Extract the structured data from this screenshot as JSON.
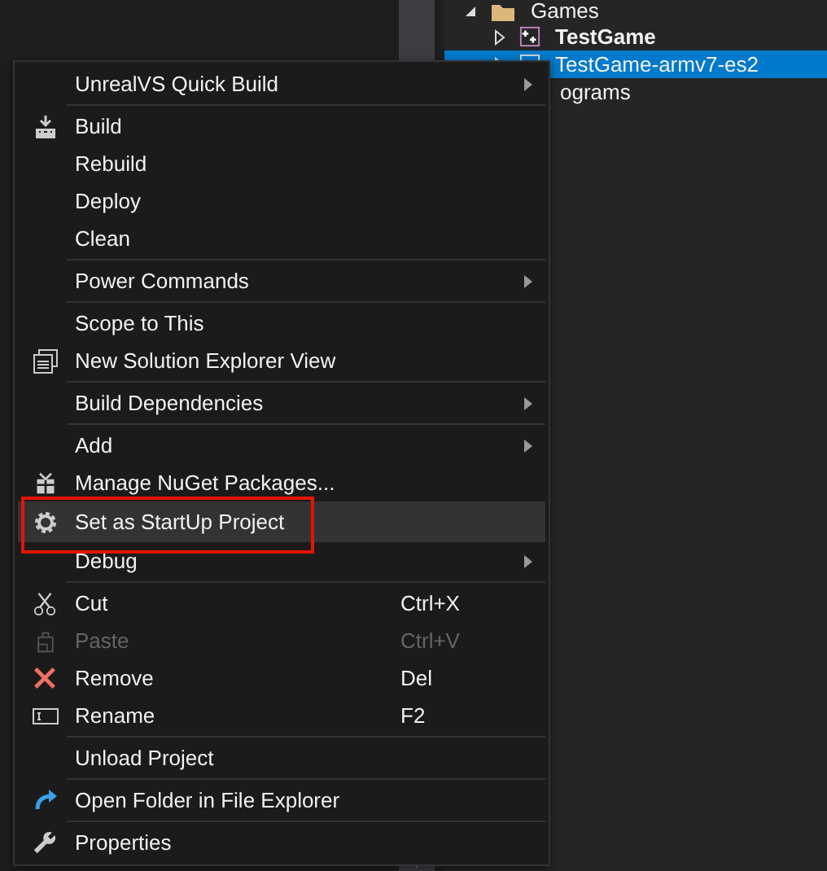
{
  "tree": {
    "items": [
      {
        "label": "Games",
        "expanded": true,
        "bold": false,
        "selected": false,
        "kind": "folder"
      },
      {
        "label": "TestGame",
        "expanded": false,
        "bold": true,
        "selected": false,
        "kind": "project"
      },
      {
        "label": "TestGame-armv7-es2",
        "expanded": false,
        "bold": false,
        "selected": true,
        "kind": "project"
      },
      {
        "label": "ograms",
        "kind": "hidden"
      }
    ]
  },
  "menu": {
    "items": [
      {
        "kind": "item",
        "label": "UnrealVS Quick Build",
        "submenu": true,
        "disabled": false,
        "selected": false,
        "annotated": false
      },
      {
        "kind": "separator"
      },
      {
        "kind": "item",
        "label": "Build",
        "submenu": false,
        "disabled": false,
        "selected": false,
        "annotated": false
      },
      {
        "kind": "item",
        "label": "Rebuild",
        "submenu": false,
        "disabled": false,
        "selected": false,
        "annotated": false
      },
      {
        "kind": "item",
        "label": "Deploy",
        "submenu": false,
        "disabled": false,
        "selected": false,
        "annotated": false
      },
      {
        "kind": "item",
        "label": "Clean",
        "submenu": false,
        "disabled": false,
        "selected": false,
        "annotated": false
      },
      {
        "kind": "separator"
      },
      {
        "kind": "item",
        "label": "Power Commands",
        "submenu": true,
        "disabled": false,
        "selected": false,
        "annotated": false
      },
      {
        "kind": "separator"
      },
      {
        "kind": "item",
        "label": "Scope to This",
        "submenu": false,
        "disabled": false,
        "selected": false,
        "annotated": false
      },
      {
        "kind": "item",
        "label": "New Solution Explorer View",
        "submenu": false,
        "disabled": false,
        "selected": false,
        "annotated": false
      },
      {
        "kind": "separator"
      },
      {
        "kind": "item",
        "label": "Build Dependencies",
        "submenu": true,
        "disabled": false,
        "selected": false,
        "annotated": false
      },
      {
        "kind": "separator"
      },
      {
        "kind": "item",
        "label": "Add",
        "submenu": true,
        "disabled": false,
        "selected": false,
        "annotated": false
      },
      {
        "kind": "item",
        "label": "Manage NuGet Packages...",
        "submenu": false,
        "disabled": false,
        "selected": false,
        "annotated": false
      },
      {
        "kind": "item",
        "label": "Set as StartUp Project",
        "submenu": false,
        "disabled": false,
        "selected": true,
        "annotated": true
      },
      {
        "kind": "item",
        "label": "Debug",
        "submenu": true,
        "disabled": false,
        "selected": false,
        "annotated": false
      },
      {
        "kind": "separator"
      },
      {
        "kind": "item",
        "label": "Cut",
        "shortcut": "Ctrl+X",
        "submenu": false,
        "disabled": false,
        "selected": false,
        "annotated": false
      },
      {
        "kind": "item",
        "label": "Paste",
        "shortcut": "Ctrl+V",
        "submenu": false,
        "disabled": true,
        "selected": false,
        "annotated": false
      },
      {
        "kind": "item",
        "label": "Remove",
        "shortcut": "Del",
        "submenu": false,
        "disabled": false,
        "selected": false,
        "annotated": false
      },
      {
        "kind": "item",
        "label": "Rename",
        "shortcut": "F2",
        "submenu": false,
        "disabled": false,
        "selected": false,
        "annotated": false
      },
      {
        "kind": "separator"
      },
      {
        "kind": "item",
        "label": "Unload Project",
        "submenu": false,
        "disabled": false,
        "selected": false,
        "annotated": false
      },
      {
        "kind": "separator"
      },
      {
        "kind": "item",
        "label": "Open Folder in File Explorer",
        "submenu": false,
        "disabled": false,
        "selected": false,
        "annotated": false
      },
      {
        "kind": "separator"
      },
      {
        "kind": "item",
        "label": "Properties",
        "submenu": false,
        "disabled": false,
        "selected": false,
        "annotated": false
      }
    ]
  }
}
